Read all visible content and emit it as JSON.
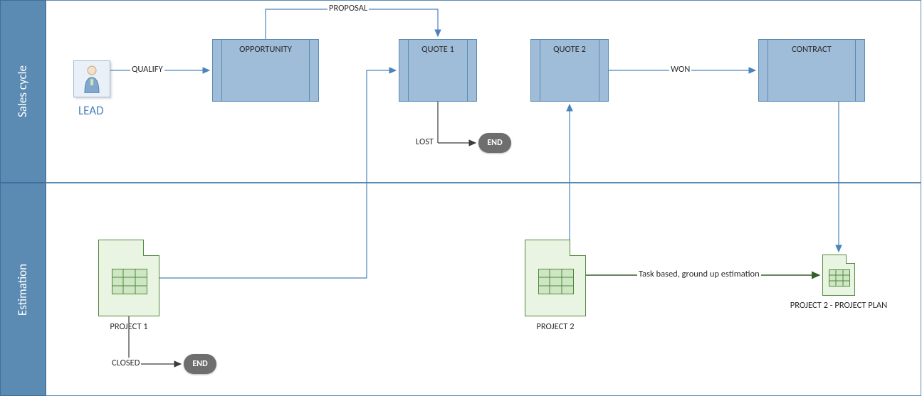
{
  "lanes": {
    "sales": {
      "title": "Sales cycle"
    },
    "estimation": {
      "title": "Estimation"
    }
  },
  "nodes": {
    "lead": {
      "label": "LEAD"
    },
    "opportunity": {
      "label": "OPPORTUNITY"
    },
    "quote1": {
      "label": "QUOTE 1"
    },
    "quote2": {
      "label": "QUOTE 2"
    },
    "contract": {
      "label": "CONTRACT"
    },
    "end_lost": {
      "label": "END"
    },
    "project1": {
      "label": "PROJECT 1"
    },
    "end_closed": {
      "label": "END"
    },
    "project2": {
      "label": "PROJECT 2"
    },
    "projplan": {
      "label": "PROJECT 2 - PROJECT PLAN"
    }
  },
  "edges": {
    "qualify": {
      "label": "QUALIFY"
    },
    "proposal": {
      "label": "PROPOSAL"
    },
    "won": {
      "label": "WON"
    },
    "lost": {
      "label": "LOST"
    },
    "closed": {
      "label": "CLOSED"
    },
    "taskbased": {
      "label": "Task based, ground up estimation"
    }
  }
}
